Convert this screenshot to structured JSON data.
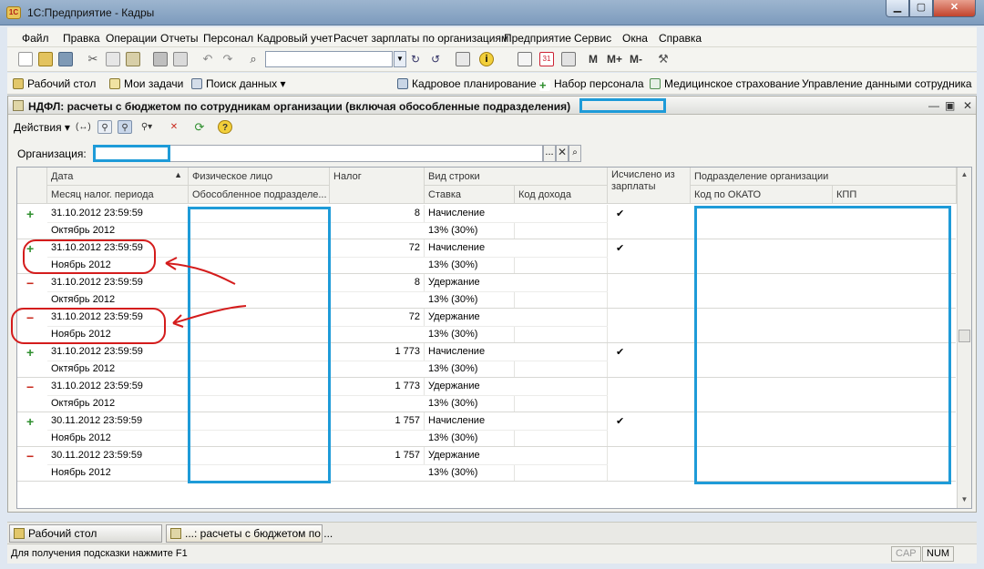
{
  "window": {
    "title": "1С:Предприятие - Кадры",
    "icon_text": "1С"
  },
  "menu": [
    "Файл",
    "Правка",
    "Операции",
    "Отчеты",
    "Персонал",
    "Кадровый учет",
    "Расчет зарплаты по организациям",
    "Предприятие",
    "Сервис",
    "Окна",
    "Справка"
  ],
  "toolbar": {
    "search_value": "",
    "m": "M",
    "m_plus": "M+",
    "m_minus": "M-"
  },
  "panel": {
    "items": [
      "Рабочий стол",
      "Мои задачи",
      "Поиск данных",
      "Кадровое планирование",
      "Набор персонала",
      "Медицинское страхование",
      "Управление данными сотрудника"
    ]
  },
  "document": {
    "title": "НДФЛ: расчеты с бюджетом по сотрудникам организации (включая обособленные подразделения)",
    "actions_label": "Действия",
    "org_label": "Организация:",
    "org_value": ""
  },
  "grid": {
    "headers": {
      "date": "Дата",
      "month": "Месяц налог. периода",
      "person": "Физическое лицо",
      "division": "Обособленное подразделе...",
      "tax": "Налог",
      "row_type": "Вид строки",
      "rate": "Ставка",
      "income_code": "Код дохода",
      "from_salary": "Исчислено из зарплаты",
      "org_unit": "Подразделение организации",
      "okato": "Код по ОКАТО",
      "kpp": "КПП"
    },
    "rows": [
      {
        "sign": "+",
        "date": "31.10.2012 23:59:59",
        "month": "Октябрь 2012",
        "tax": "8",
        "type": "Начисление",
        "rate": "13% (30%)",
        "check": "✔"
      },
      {
        "sign": "+",
        "date": "31.10.2012 23:59:59",
        "month": "Ноябрь 2012",
        "tax": "72",
        "type": "Начисление",
        "rate": "13% (30%)",
        "check": "✔"
      },
      {
        "sign": "−",
        "date": "31.10.2012 23:59:59",
        "month": "Октябрь 2012",
        "tax": "8",
        "type": "Удержание",
        "rate": "13% (30%)",
        "check": ""
      },
      {
        "sign": "−",
        "date": "31.10.2012 23:59:59",
        "month": "Ноябрь 2012",
        "tax": "72",
        "type": "Удержание",
        "rate": "13% (30%)",
        "check": ""
      },
      {
        "sign": "+",
        "date": "31.10.2012 23:59:59",
        "month": "Октябрь 2012",
        "tax": "1 773",
        "type": "Начисление",
        "rate": "13% (30%)",
        "check": "✔"
      },
      {
        "sign": "−",
        "date": "31.10.2012 23:59:59",
        "month": "Октябрь 2012",
        "tax": "1 773",
        "type": "Удержание",
        "rate": "13% (30%)",
        "check": ""
      },
      {
        "sign": "+",
        "date": "30.11.2012 23:59:59",
        "month": "Ноябрь 2012",
        "tax": "1 757",
        "type": "Начисление",
        "rate": "13% (30%)",
        "check": "✔"
      },
      {
        "sign": "−",
        "date": "30.11.2012 23:59:59",
        "month": "Ноябрь 2012",
        "tax": "1 757",
        "type": "Удержание",
        "rate": "13% (30%)",
        "check": ""
      }
    ]
  },
  "taskbar": [
    "Рабочий стол",
    "...: расчеты с бюджетом по ..."
  ],
  "status": {
    "hint": "Для получения подсказки нажмите F1",
    "cap": "CAP",
    "num": "NUM"
  },
  "colors": {
    "highlight_box": "#1e9bd8",
    "annotation": "#d41c1c",
    "plus": "#2f8f2f",
    "minus": "#c8281c"
  }
}
